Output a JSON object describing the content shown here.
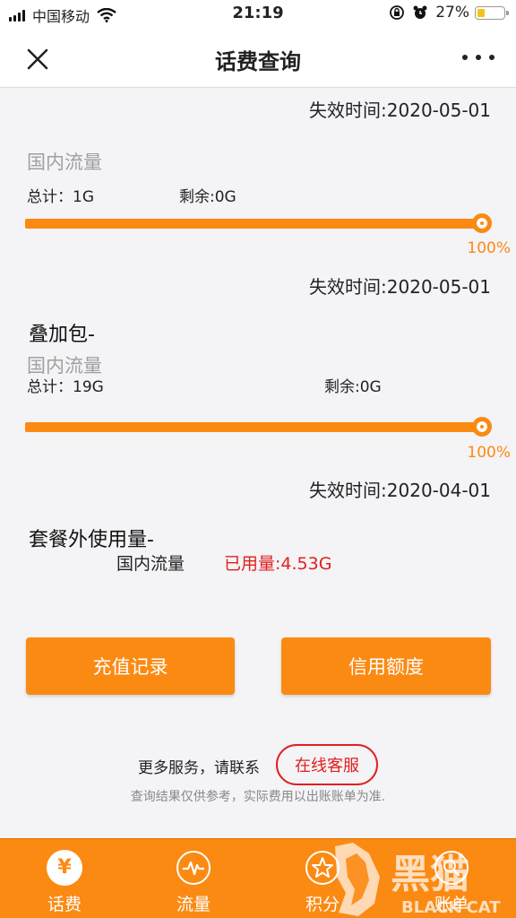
{
  "status_bar": {
    "carrier": "中国移动",
    "time": "21:19",
    "battery_percent": "27%",
    "battery_level": 0.27
  },
  "nav": {
    "title": "话费查询",
    "close_icon": "close-icon",
    "more_icon": "more-dots-icon"
  },
  "packages": [
    {
      "expire": "失效时间:2020-05-01",
      "category": "国内流量",
      "total": "总计：1G",
      "remaining": "剩余:0G",
      "percent_text": "100%",
      "percent": 100,
      "next_expire": "失效时间:2020-05-01"
    },
    {
      "title": "叠加包-",
      "category": "国内流量",
      "total": "总计：19G",
      "remaining": "剩余:0G",
      "percent_text": "100%",
      "percent": 100,
      "next_expire": "失效时间:2020-04-01"
    }
  ],
  "overage": {
    "title": "套餐外使用量-",
    "category": "国内流量",
    "used": "已用量:4.53G"
  },
  "buttons": {
    "recharge": "充值记录",
    "credit": "信用额度"
  },
  "service": {
    "text": "更多服务，请联系",
    "button": "在线客服",
    "disclaimer": "查询结果仅供参考，实际费用以出账账单为准."
  },
  "tabs": [
    {
      "label": "话费",
      "icon": "yuan-icon",
      "symbol": "¥"
    },
    {
      "label": "流量",
      "icon": "pulse-icon"
    },
    {
      "label": "积分",
      "icon": "star-icon"
    },
    {
      "label": "账单",
      "icon": "search-icon"
    }
  ],
  "watermark": {
    "text": "黑猫",
    "subtext": "BLACK CAT"
  },
  "colors": {
    "accent": "#fb8a13",
    "alert": "#e02020"
  }
}
